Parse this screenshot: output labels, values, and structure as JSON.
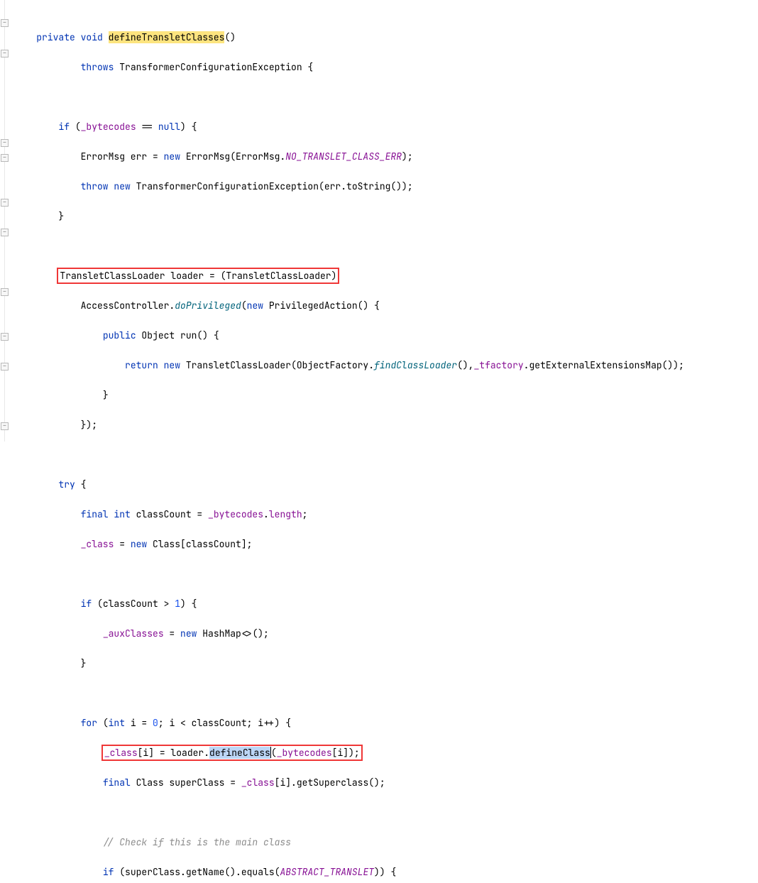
{
  "code": {
    "l1a": "private",
    "l1b": " void",
    "l1c": "defineTransletClasses",
    "l1d": "()",
    "l2a": "throws",
    "l2b": " TransformerConfigurationException {",
    "l4a": "if",
    "l4b": " (",
    "l4c": "_bytecodes",
    "l4d": " == ",
    "l4e": "null",
    "l4f": ") {",
    "l5a": "ErrorMsg err = ",
    "l5b": "new",
    "l5c": " ErrorMsg(ErrorMsg.",
    "l5d": "NO_TRANSLET_CLASS_ERR",
    "l5e": ");",
    "l6a": "throw new",
    "l6b": " TransformerConfigurationException(err.toString());",
    "l7a": "}",
    "l9a": "TransletClassLoader loader = (TransletClassLoader)",
    "l10a": "AccessController.",
    "l10b": "doPrivileged",
    "l10c": "(",
    "l10d": "new",
    "l10e": " PrivilegedAction() {",
    "l11a": "public",
    "l11b": " Object run() {",
    "l12a": "return new",
    "l12b": " TransletClassLoader(ObjectFactory.",
    "l12c": "findClassLoader",
    "l12d": "(),",
    "l12e": "_tfactory",
    "l12f": ".getExternalExtensionsMap());",
    "l13a": "}",
    "l14a": "});",
    "l16a": "try",
    "l16b": " {",
    "l17a": "final int",
    "l17b": " classCount = ",
    "l17c": "_bytecodes",
    "l17d": ".",
    "l17e": "length",
    "l17f": ";",
    "l18a": "_class",
    "l18b": " = ",
    "l18c": "new",
    "l18d": " Class[classCount];",
    "l20a": "if",
    "l20b": " (classCount > ",
    "l20c": "1",
    "l20d": ") {",
    "l21a": "_auxClasses",
    "l21b": " = ",
    "l21c": "new",
    "l21d": " HashMap<>();",
    "l22a": "}",
    "l24a": "for",
    "l24b": " (",
    "l24c": "int",
    "l24d": " i = ",
    "l24e": "0",
    "l24f": "; i < classCount; i++) {",
    "l25a": "_class",
    "l25b": "[i] = loader.",
    "l25c": "defineClass",
    "l25d": "(",
    "l25e": "_bytecodes",
    "l25f": "[i]);",
    "l26a": "final",
    "l26b": " Class superClass = ",
    "l26c": "_class",
    "l26d": "[i].getSuperclass();",
    "l28a": "// Check if this is the main class",
    "l29a": "if",
    "l29b": " (superClass.getName().equals(",
    "l29c": "ABSTRACT_TRANSLET",
    "l29d": ")) {"
  }
}
